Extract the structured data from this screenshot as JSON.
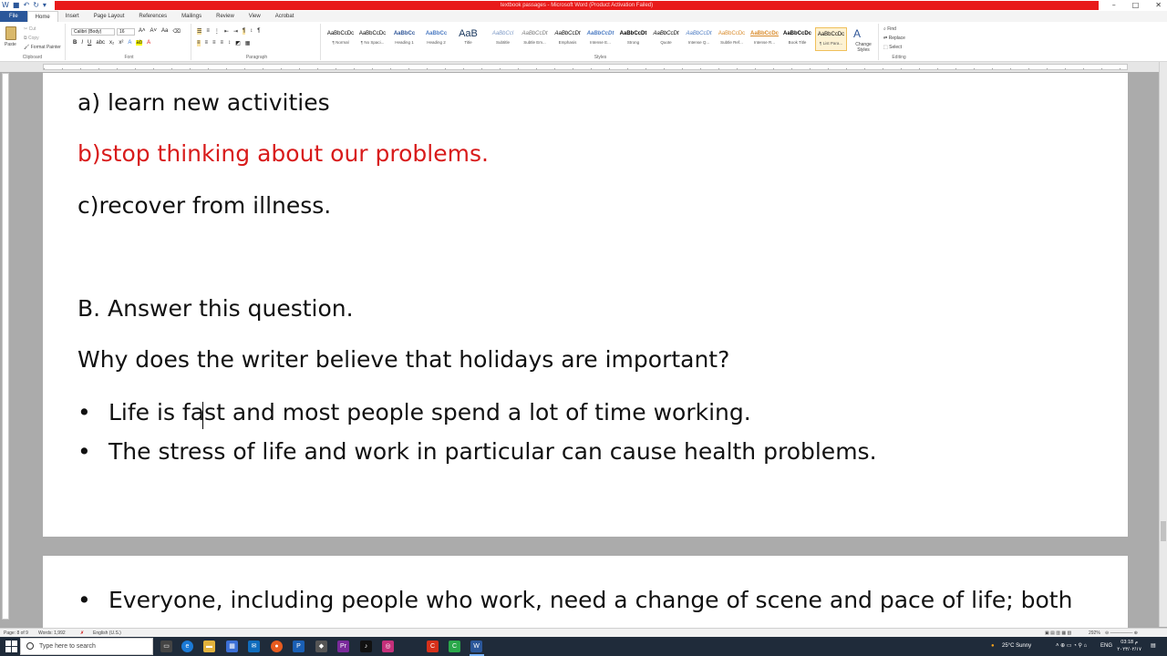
{
  "window": {
    "title": "textbook passages - Microsoft Word (Product Activation Failed)",
    "minimize": "–",
    "maximize": "□",
    "close": "✕"
  },
  "ribbon": {
    "tabs": [
      "File",
      "Home",
      "Insert",
      "Page Layout",
      "References",
      "Mailings",
      "Review",
      "View",
      "Acrobat"
    ],
    "clipboard": {
      "paste": "Paste",
      "cut": "Cut",
      "copy": "Copy",
      "format_painter": "Format Painter",
      "label": "Clipboard"
    },
    "font": {
      "name": "Calibri (Body)",
      "size": "16",
      "label": "Font"
    },
    "paragraph": {
      "label": "Paragraph"
    },
    "styles": {
      "label": "Styles",
      "items": [
        {
          "sample": "AaBbCcDc",
          "name": "¶ Normal"
        },
        {
          "sample": "AaBbCcDc",
          "name": "¶ No Spaci..."
        },
        {
          "sample": "AaBbCc",
          "name": "Heading 1"
        },
        {
          "sample": "AaBbCc",
          "name": "Heading 2"
        },
        {
          "sample": "AaB",
          "name": "Title"
        },
        {
          "sample": "AaBbCcl",
          "name": "Subtitle"
        },
        {
          "sample": "AaBbCcDt",
          "name": "Subtle Em..."
        },
        {
          "sample": "AaBbCcDt",
          "name": "Emphasis"
        },
        {
          "sample": "AaBbCcDt",
          "name": "Intense E..."
        },
        {
          "sample": "AaBbCcDt",
          "name": "Strong"
        },
        {
          "sample": "AaBbCcDt",
          "name": "Quote"
        },
        {
          "sample": "AaBbCcDt",
          "name": "Intense Q..."
        },
        {
          "sample": "AaBbCcDc",
          "name": "Subtle Ref..."
        },
        {
          "sample": "AaBbCcDc",
          "name": "Intense R..."
        },
        {
          "sample": "AaBbCcDc",
          "name": "Book Title"
        },
        {
          "sample": "AaBbCcDc",
          "name": "¶ List Para..."
        }
      ],
      "change_styles": "Change Styles"
    },
    "editing": {
      "find": "Find",
      "replace": "Replace",
      "select": "Select",
      "label": "Editing"
    }
  },
  "document": {
    "page1": {
      "line_a": "a) learn new activities",
      "line_b": "b)stop thinking about our problems.",
      "line_c": "c)recover from illness.",
      "section_b": "B. Answer this question.",
      "question": "Why does the writer believe that holidays are important?",
      "bullets": [
        "Life is fast and most  people spend a lot of time working.",
        "The stress of life and work in particular can cause health problems."
      ]
    },
    "page2": {
      "bullets": [
        "Everyone, including people who work, need a change of scene and pace of life; both"
      ]
    },
    "bullet_char": "•"
  },
  "status_bar": {
    "page": "Page: 8 of 9",
    "words": "Words: 1,992",
    "language": "English (U.S.)",
    "zoom": "292%"
  },
  "taskbar": {
    "search_placeholder": "Type here to search",
    "weather": "25°C  Sunny",
    "language": "ENG",
    "time": "03:18 م",
    "date": "٢٠٢٣/٠٢/١٧"
  },
  "colors": {
    "title_red": "#e81a1a",
    "file_tab": "#2b579a",
    "answer_red": "#d81b1b",
    "taskbar": "#1f2b3a"
  }
}
